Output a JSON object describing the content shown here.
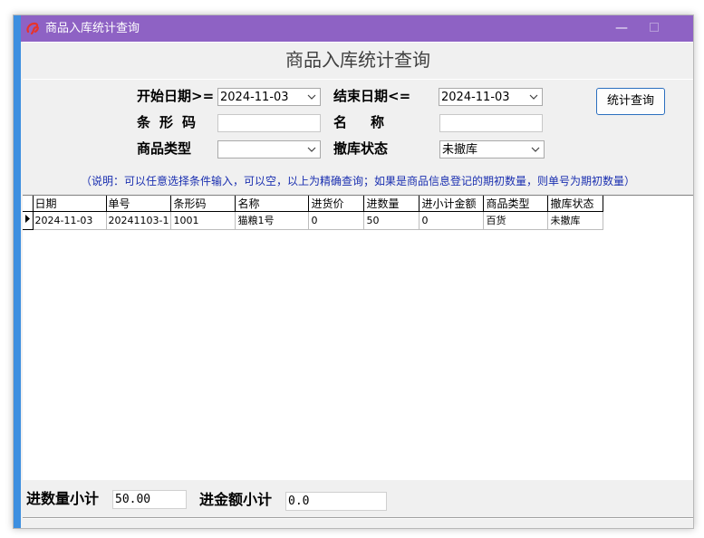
{
  "window": {
    "title": "商品入库统计查询",
    "minimize_glyph": "—"
  },
  "header": {
    "title": "商品入库统计查询"
  },
  "criteria": {
    "start_date_label": "开始日期>=",
    "start_date_value": "2024-11-03",
    "end_date_label": "结束日期<=",
    "end_date_value": "2024-11-03",
    "barcode_label": "条形码",
    "barcode_value": "",
    "name_label": "名称",
    "name_value": "",
    "category_label": "商品类型",
    "category_value": "",
    "cancel_status_label": "撤库状态",
    "cancel_status_value": "未撤库",
    "query_button": "统计查询",
    "note": "（说明：可以任意选择条件输入，可以空，以上为精确查询；如果是商品信息登记的期初数量，则单号为期初数量）"
  },
  "grid": {
    "columns": [
      "日期",
      "单号",
      "条形码",
      "名称",
      "进货价",
      "进数量",
      "进小计金额",
      "商品类型",
      "撤库状态"
    ],
    "rows": [
      [
        "2024-11-03",
        "20241103-1",
        "1001",
        "猫粮1号",
        "0",
        "50",
        "0",
        "百货",
        "未撤库"
      ]
    ]
  },
  "footer": {
    "qty_total_label": "进数量小计",
    "qty_total_value": "50.00",
    "amount_total_label": "进金额小计",
    "amount_total_value": "0.0"
  },
  "colors": {
    "titlebar": "#8e62c4",
    "side_accent": "#3d8fe0",
    "note_text": "#1a2fb0",
    "button_border": "#2b6fbf"
  },
  "icons": {
    "app_logo": "app-logo-icon",
    "dropdown": "chevron-down-icon",
    "row_pointer": "row-pointer-icon"
  }
}
